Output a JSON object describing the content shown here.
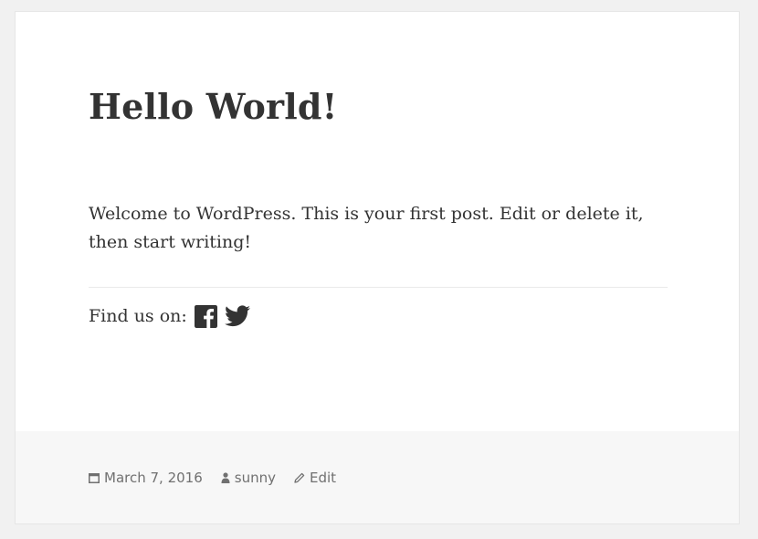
{
  "post": {
    "title": "Hello World!",
    "body": "Welcome to WordPress. This is your first post. Edit or delete it, then start writing!"
  },
  "share": {
    "label": "Find us on:",
    "icons": [
      "facebook-icon",
      "twitter-icon"
    ]
  },
  "footer": {
    "date": "March 7, 2016",
    "author": "sunny",
    "edit_label": "Edit",
    "icons": [
      "calendar-icon",
      "person-icon",
      "pencil-icon"
    ]
  },
  "colors": {
    "page_background": "#f1f1f1",
    "card_background": "#ffffff",
    "footer_background": "#f7f7f7",
    "text": "#333333",
    "meta_text": "#707070"
  }
}
